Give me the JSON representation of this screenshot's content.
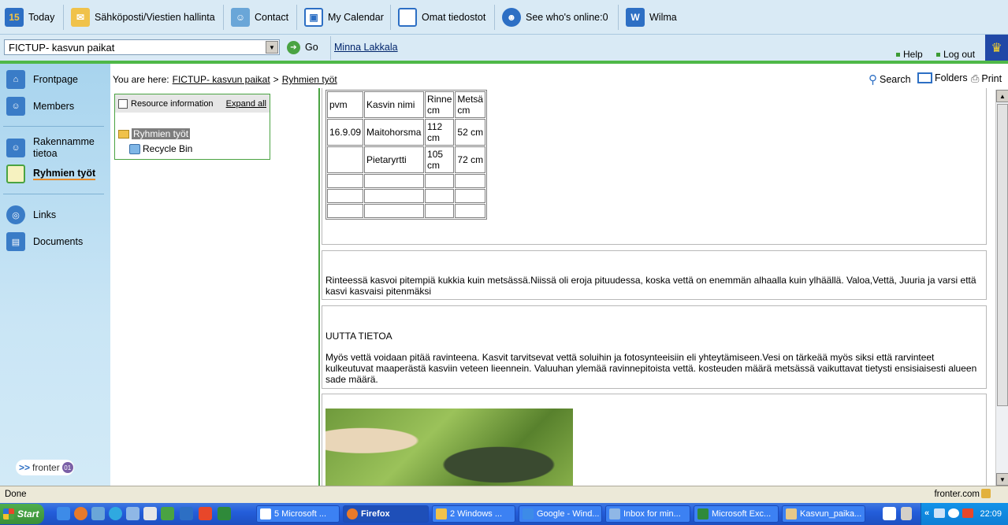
{
  "toolbar": {
    "today": "Today",
    "mail": "Sähköposti/Viestien hallinta",
    "contact": "Contact",
    "calendar": "My Calendar",
    "files": "Omat tiedostot",
    "online": "See who's online:0",
    "wilma": "Wilma",
    "today_badge": "15"
  },
  "room_select": {
    "value": "FICTUP- kasvun paikat",
    "go_label": "Go"
  },
  "user_name": "Minna Lakkala",
  "help_label": "Help",
  "logout_label": "Log out",
  "sidebar": {
    "items": [
      {
        "label": "Frontpage"
      },
      {
        "label": "Members"
      },
      {
        "label": "Rakennamme tietoa"
      },
      {
        "label": "Ryhmien työt"
      },
      {
        "label": "Links"
      },
      {
        "label": "Documents"
      }
    ],
    "logo_text": "fronter",
    "logo_badge": "01"
  },
  "breadcrumb": {
    "prefix": "You are here:",
    "level1": "FICTUP- kasvun paikat",
    "separator": ">",
    "level2": "Ryhmien työt"
  },
  "tools": {
    "search": "Search",
    "folders": "Folders",
    "print": "Print"
  },
  "tree": {
    "resource_info": "Resource information",
    "expand_all": "Expand all",
    "root": "Ryhmien työt",
    "child": "Recycle Bin"
  },
  "table": {
    "headers": [
      "pvm",
      "Kasvin nimi",
      "Rinne cm",
      "Metsä cm"
    ],
    "rows": [
      [
        "16.9.09",
        "Maitohorsma",
        "112 cm",
        "52 cm"
      ],
      [
        "",
        "Pietaryrtti",
        "105 cm",
        "72 cm"
      ]
    ]
  },
  "paragraph1": "Rinteessä kasvoi pitempiä kukkia kuin metsässä.Niissä oli eroja pituudessa, koska vettä on enemmän alhaalla kuin ylhäällä.  Valoa,Vettä, Juuria ja varsi että kasvi kasvaisi pitenmäksi",
  "section2": {
    "title": "UUTTA TIETOA",
    "text": "Myös vettä voidaan pitää ravinteena. Kasvit tarvitsevat vettä soluihin ja fotosynteeisiin eli yhteytämiseen.Vesi on tärkeää myös siksi että rarvinteet kulkeutuvat maaperästä kasviin veteen lieennein. Valuuhan ylemää ravinnepitoista vettä. kosteuden määrä metsässä vaikuttavat tietysti ensisiaisesti alueen sade määrä."
  },
  "status": {
    "text": "Done",
    "domain": "fronter.com"
  },
  "taskbar": {
    "start": "Start",
    "tasks": [
      {
        "label": "5 Microsoft ..."
      },
      {
        "label": "Firefox"
      },
      {
        "label": "2 Windows ..."
      },
      {
        "label": "Google - Wind..."
      },
      {
        "label": "Inbox for min..."
      },
      {
        "label": "Microsoft Exc..."
      },
      {
        "label": "Kasvun_paika..."
      }
    ],
    "clock": "22:09"
  }
}
